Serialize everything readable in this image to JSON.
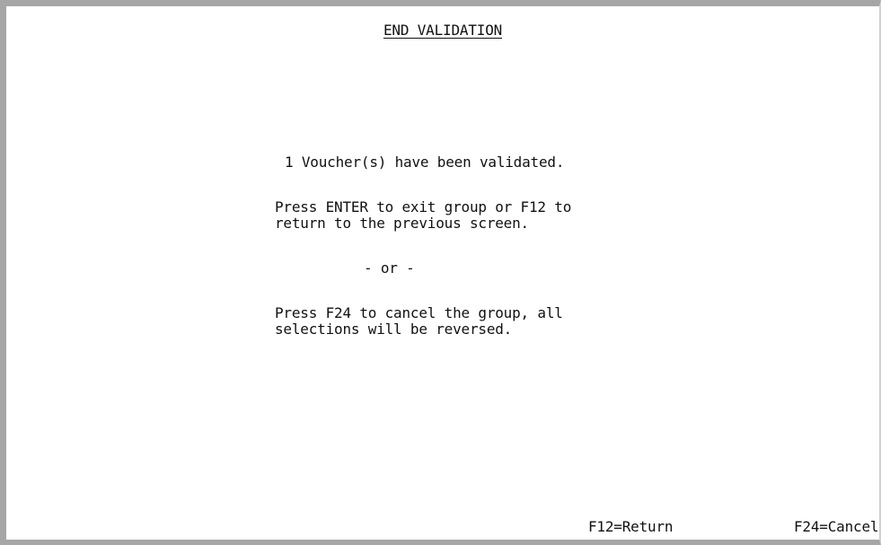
{
  "screen": {
    "title": "END VALIDATION",
    "message_validated": "1 Voucher(s) have been validated.",
    "message_enter_line1": "Press ENTER to exit group or F12 to",
    "message_enter_line2": "return to the previous screen.",
    "separator": "- or -",
    "message_cancel_line1": "Press F24 to cancel the group, all",
    "message_cancel_line2": "selections will be reversed."
  },
  "function_keys": {
    "return_label": "F12=Return",
    "cancel_label": "F24=Cancel"
  },
  "colors": {
    "border": "#a6a6a6",
    "text": "#111111",
    "background": "#ffffff"
  }
}
